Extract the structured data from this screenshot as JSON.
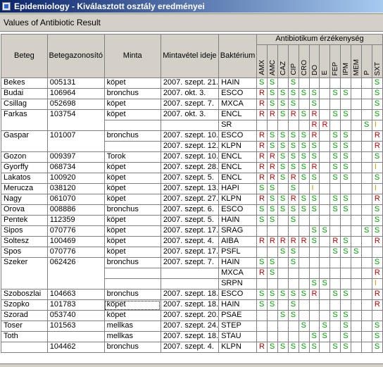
{
  "window": {
    "title": "Epidemiology - Kiválasztott osztály eredményei"
  },
  "subtitle": "Values of Antibiotic Result",
  "headers": {
    "beteg": "Beteg",
    "betegazonosito": "Betegazonosító",
    "minta": "Minta",
    "mintavetel": "Mintavétel ideje",
    "bakterium": "Baktérium",
    "group": "Antibiotikum érzékenység"
  },
  "antibiotics": [
    "AMX",
    "AMC",
    "CAZ",
    "CIP",
    "CRO",
    "DO",
    "E",
    "FEP",
    "IPM",
    "MEM",
    "P",
    "SXT"
  ],
  "colors": {
    "S": "#00a000",
    "R": "#c00000",
    "I": "#c8a000"
  },
  "patients": [
    {
      "name": "Bekes",
      "id": "005131",
      "rows": [
        {
          "minta": "köpet",
          "date": "2007. szept. 21.",
          "bak": "HAIN",
          "res": [
            "S",
            "S",
            "",
            "S",
            "",
            "",
            "",
            "",
            "",
            "",
            "",
            "S"
          ]
        }
      ]
    },
    {
      "name": "Budai",
      "id": "106964",
      "rows": [
        {
          "minta": "bronchus",
          "date": "2007. okt. 3.",
          "bak": "ESCO",
          "res": [
            "R",
            "S",
            "S",
            "S",
            "S",
            "S",
            "",
            "S",
            "S",
            "",
            "",
            "S"
          ]
        }
      ]
    },
    {
      "name": "Csillag",
      "id": "052698",
      "rows": [
        {
          "minta": "köpet",
          "date": "2007. szept. 7.",
          "bak": "MXCA",
          "res": [
            "R",
            "S",
            "S",
            "S",
            "",
            "S",
            "",
            "",
            "",
            "",
            "",
            "S"
          ]
        }
      ]
    },
    {
      "name": "Farkas",
      "id": "103754",
      "rows": [
        {
          "minta": "köpet",
          "date": "2007. okt. 3.",
          "bak": "ENCL",
          "res": [
            "R",
            "R",
            "S",
            "R",
            "S",
            "R",
            "",
            "S",
            "S",
            "",
            "",
            "S"
          ]
        },
        {
          "minta": "",
          "date": "",
          "bak": "SR",
          "res": [
            "",
            "",
            "",
            "",
            "",
            "R",
            "R",
            "",
            "",
            "",
            "S",
            "I"
          ]
        }
      ]
    },
    {
      "name": "Gaspar",
      "id": "101007",
      "rows": [
        {
          "minta": "bronchus",
          "date": "2007. szept. 10.",
          "bak": "ESCO",
          "res": [
            "R",
            "S",
            "S",
            "S",
            "S",
            "R",
            "",
            "S",
            "S",
            "",
            "",
            "R"
          ]
        },
        {
          "minta": "",
          "date": "2007. szept. 12.",
          "bak": "KLPN",
          "res": [
            "R",
            "S",
            "S",
            "S",
            "S",
            "S",
            "",
            "S",
            "S",
            "",
            "",
            "R"
          ]
        }
      ]
    },
    {
      "name": "Gozon",
      "id": "009397",
      "rows": [
        {
          "minta": "Torok",
          "date": "2007. szept. 10.",
          "bak": "ENCL",
          "res": [
            "R",
            "R",
            "S",
            "S",
            "S",
            "S",
            "",
            "S",
            "S",
            "",
            "",
            "S"
          ]
        }
      ]
    },
    {
      "name": "Gyorffy",
      "id": "068734",
      "rows": [
        {
          "minta": "köpet",
          "date": "2007. szept. 28.",
          "bak": "ENCL",
          "res": [
            "R",
            "R",
            "S",
            "S",
            "S",
            "R",
            "",
            "S",
            "S",
            "",
            "",
            "I"
          ]
        }
      ]
    },
    {
      "name": "Lakatos",
      "id": "100920",
      "rows": [
        {
          "minta": "köpet",
          "date": "2007. szept. 5.",
          "bak": "ENCL",
          "res": [
            "R",
            "R",
            "S",
            "R",
            "S",
            "S",
            "",
            "S",
            "S",
            "",
            "",
            "S"
          ]
        }
      ]
    },
    {
      "name": "Merucza",
      "id": "038120",
      "rows": [
        {
          "minta": "köpet",
          "date": "2007. szept. 13.",
          "bak": "HAPI",
          "res": [
            "S",
            "S",
            "",
            "S",
            "",
            "I",
            "",
            "",
            "",
            "",
            "",
            "I"
          ]
        }
      ]
    },
    {
      "name": "Nagy",
      "id": "061070",
      "rows": [
        {
          "minta": "köpet",
          "date": "2007. szept. 27.",
          "bak": "KLPN",
          "res": [
            "R",
            "S",
            "S",
            "R",
            "S",
            "S",
            "",
            "S",
            "S",
            "",
            "",
            "R"
          ]
        }
      ]
    },
    {
      "name": "Orova",
      "id": "008886",
      "rows": [
        {
          "minta": "bronchus",
          "date": "2007. szept. 6.",
          "bak": "ESCO",
          "res": [
            "S",
            "S",
            "S",
            "S",
            "S",
            "S",
            "",
            "S",
            "S",
            "",
            "",
            "S"
          ]
        }
      ]
    },
    {
      "name": "Pentek",
      "id": "112359",
      "rows": [
        {
          "minta": "köpet",
          "date": "2007. szept. 5.",
          "bak": "HAIN",
          "res": [
            "S",
            "S",
            "",
            "S",
            "",
            "",
            "",
            "",
            "",
            "",
            "",
            "S"
          ]
        }
      ]
    },
    {
      "name": "Sipos",
      "id": "070776",
      "rows": [
        {
          "minta": "köpet",
          "date": "2007. szept. 17.",
          "bak": "SRAG",
          "res": [
            "",
            "",
            "",
            "",
            "",
            "S",
            "S",
            "",
            "",
            "",
            "S",
            "S"
          ]
        }
      ]
    },
    {
      "name": "Soltesz",
      "id": "100469",
      "rows": [
        {
          "minta": "köpet",
          "date": "2007. szept. 4.",
          "bak": "AIBA",
          "res": [
            "R",
            "R",
            "R",
            "R",
            "R",
            "S",
            "",
            "R",
            "S",
            "",
            "",
            "R"
          ]
        }
      ]
    },
    {
      "name": "Spos",
      "id": "070776",
      "rows": [
        {
          "minta": "köpet",
          "date": "2007. szept. 17.",
          "bak": "PSFL",
          "res": [
            "",
            "",
            "S",
            "S",
            "",
            "",
            "",
            "S",
            "S",
            "S",
            "",
            ""
          ]
        }
      ]
    },
    {
      "name": "Szeker",
      "id": "062426",
      "rows": [
        {
          "minta": "bronchus",
          "date": "2007. szept. 7.",
          "bak": "HAIN",
          "res": [
            "S",
            "S",
            "",
            "S",
            "",
            "",
            "",
            "",
            "",
            "",
            "",
            "S"
          ]
        },
        {
          "minta": "",
          "date": "",
          "bak": "MXCA",
          "res": [
            "R",
            "S",
            "",
            "",
            "",
            "",
            "",
            "",
            "",
            "",
            "",
            "R"
          ]
        },
        {
          "minta": "",
          "date": "",
          "bak": "SRPN",
          "res": [
            "",
            "",
            "",
            "",
            "",
            "S",
            "S",
            "",
            "",
            "",
            "",
            "I"
          ]
        }
      ]
    },
    {
      "name": "Szoboszlai",
      "id": "104663",
      "rows": [
        {
          "minta": "bronchus",
          "date": "2007. szept. 18.",
          "bak": "ESCO",
          "res": [
            "S",
            "S",
            "S",
            "S",
            "S",
            "R",
            "",
            "S",
            "S",
            "",
            "",
            "R"
          ]
        }
      ]
    },
    {
      "name": "Szopko",
      "id": "101783",
      "rows": [
        {
          "minta": "köpet",
          "date": "2007. szept. 18.",
          "bak": "HAIN",
          "res": [
            "S",
            "S",
            "",
            "S",
            "",
            "",
            "",
            "",
            "",
            "",
            "",
            "R"
          ],
          "selected_minta": true
        }
      ]
    },
    {
      "name": "Szorad",
      "id": "053740",
      "rows": [
        {
          "minta": "köpet",
          "date": "2007. szept. 20.",
          "bak": "PSAE",
          "res": [
            "",
            "",
            "S",
            "S",
            "",
            "",
            "",
            "S",
            "S",
            "",
            "",
            ""
          ]
        }
      ]
    },
    {
      "name": "Toser",
      "id": "101563",
      "rows": [
        {
          "minta": "mellkas",
          "date": "2007. szept. 24.",
          "bak": "STEP",
          "res": [
            "",
            "",
            "",
            "",
            "S",
            "",
            "S",
            "",
            "S",
            "",
            "",
            "S"
          ]
        }
      ]
    },
    {
      "name": "Toth",
      "id": "",
      "rows": [
        {
          "minta": "mellkas",
          "date": "2007. szept. 18.",
          "bak": "STAU",
          "res": [
            "",
            "",
            "",
            "",
            "",
            "S",
            "S",
            "",
            "S",
            "",
            "",
            "S"
          ]
        }
      ]
    },
    {
      "name": "",
      "id": "104462",
      "rows": [
        {
          "minta": "bronchus",
          "date": "2007. szept. 4.",
          "bak": "KLPN",
          "res": [
            "R",
            "S",
            "S",
            "S",
            "S",
            "S",
            "",
            "S",
            "S",
            "",
            "",
            "S"
          ]
        }
      ]
    }
  ]
}
